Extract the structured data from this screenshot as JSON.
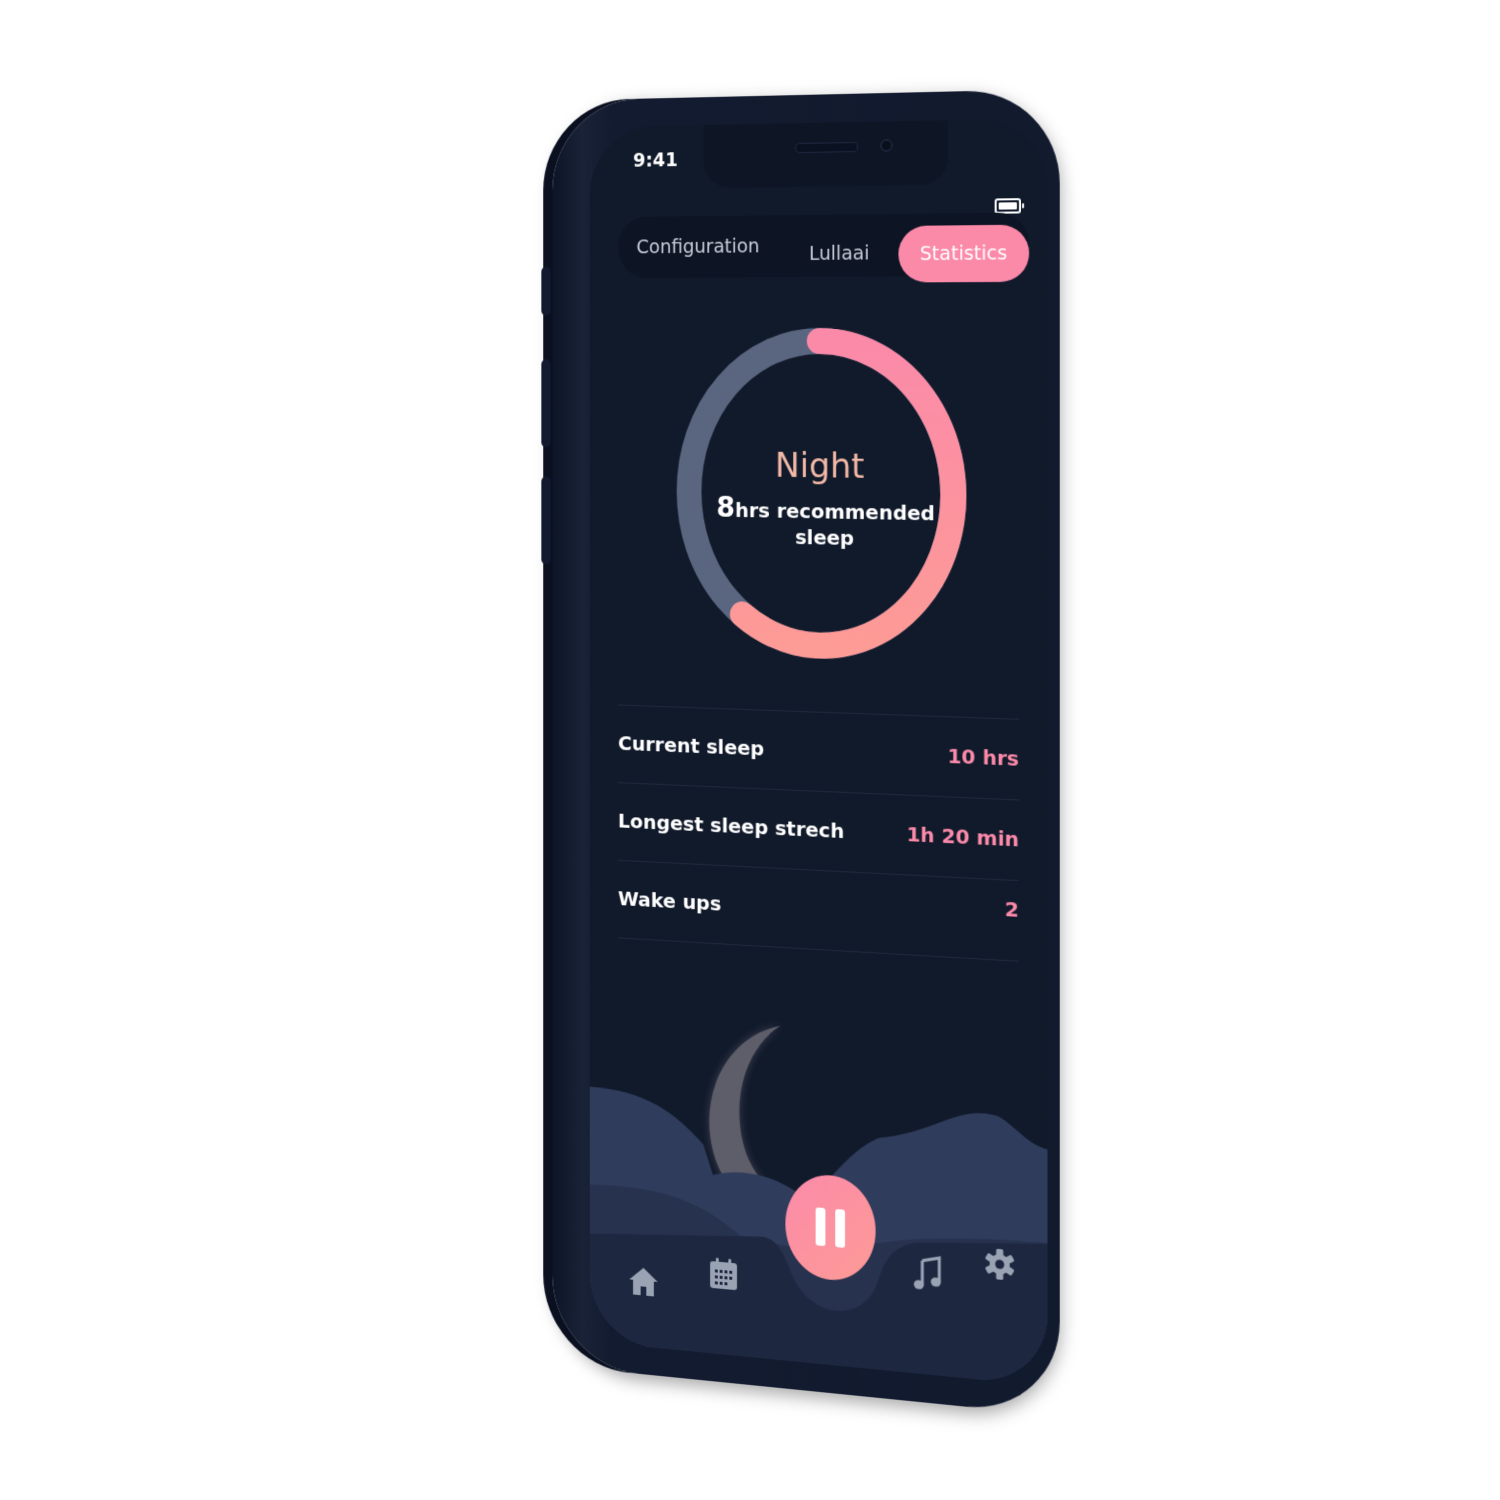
{
  "status_bar": {
    "time": "9:41"
  },
  "tabs": [
    {
      "label": "Configuration",
      "active": false
    },
    {
      "label": "Lullaai",
      "active": false
    },
    {
      "label": "Statistics",
      "active": true
    }
  ],
  "ring": {
    "title": "Night",
    "hours_number": "8",
    "hours_text": "hrs recommended",
    "hours_text_line2": "sleep",
    "progress": 0.6,
    "progress_color": "#fb8aa9",
    "track_color": "#5a6680"
  },
  "stats": [
    {
      "label": "Current sleep",
      "value": "10 hrs"
    },
    {
      "label": "Longest sleep strech",
      "value": "1h 20 min"
    },
    {
      "label": "Wake ups",
      "value": "2"
    }
  ],
  "nav": {
    "items": [
      {
        "icon": "home-icon"
      },
      {
        "icon": "calendar-icon"
      },
      {
        "icon": "pause-icon"
      },
      {
        "icon": "music-note-icon"
      },
      {
        "icon": "gear-icon"
      }
    ]
  },
  "colors": {
    "accent": "#fb8aa9",
    "background": "#111a2b",
    "phone_body": "#131b30"
  }
}
